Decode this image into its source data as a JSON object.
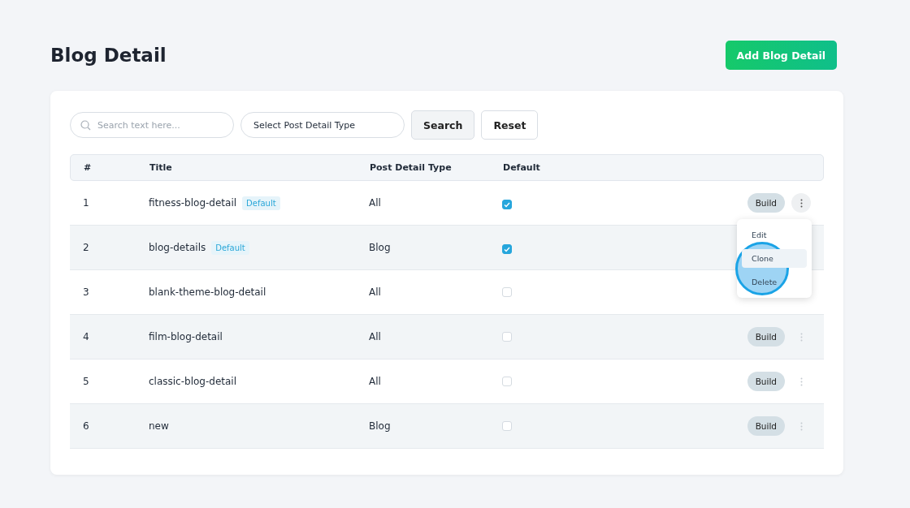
{
  "page_title": "Blog Detail",
  "add_button": "Add Blog Detail",
  "filters": {
    "search_placeholder": "Search text here...",
    "type_select": "Select Post Detail Type",
    "search_button": "Search",
    "reset_button": "Reset"
  },
  "table": {
    "columns": [
      "#",
      "Title",
      "Post Detail Type",
      "Default"
    ],
    "rows": [
      {
        "index": "1",
        "title": "fitness-blog-detail",
        "badge": "Default",
        "type": "All",
        "default": true,
        "build": "Build",
        "menu_open": true
      },
      {
        "index": "2",
        "title": "blog-details",
        "badge": "Default",
        "type": "Blog",
        "default": true
      },
      {
        "index": "3",
        "title": "blank-theme-blog-detail",
        "type": "All",
        "default": false
      },
      {
        "index": "4",
        "title": "film-blog-detail",
        "type": "All",
        "default": false,
        "build": "Build",
        "menu_open": false
      },
      {
        "index": "5",
        "title": "classic-blog-detail",
        "type": "All",
        "default": false,
        "build": "Build",
        "menu_open": false
      },
      {
        "index": "6",
        "title": "new",
        "type": "Blog",
        "default": false,
        "build": "Build",
        "menu_open": false
      }
    ]
  },
  "row_menu": {
    "items": [
      {
        "label": "Edit",
        "selected": false
      },
      {
        "label": "Clone",
        "selected": true
      },
      {
        "label": "Delete",
        "selected": false
      }
    ]
  }
}
